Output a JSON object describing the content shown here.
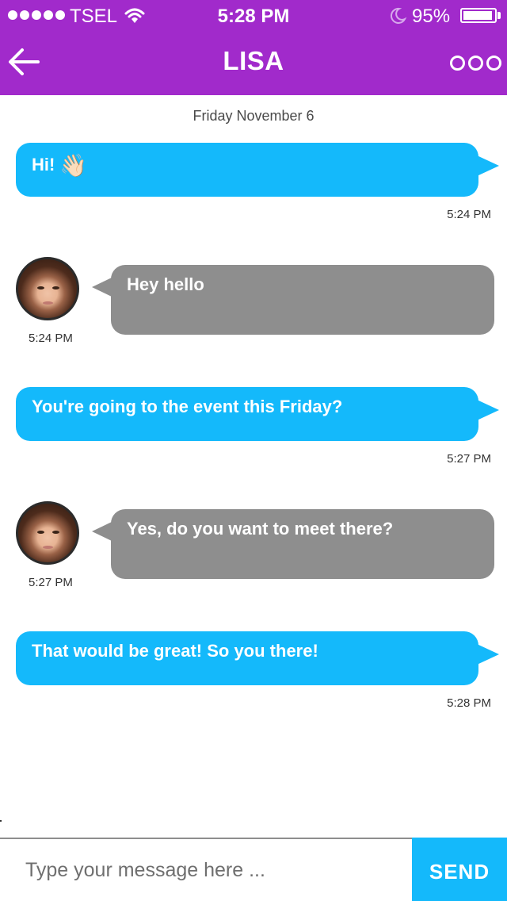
{
  "status_bar": {
    "carrier": "TSEL",
    "time": "5:28 PM",
    "battery_percent": "95%",
    "battery_level": 0.95,
    "signal_icon": "signal-dots-icon",
    "wifi_icon": "wifi-icon",
    "moon_icon": "moon-icon"
  },
  "nav": {
    "title": "LISA",
    "back_icon": "arrow-left-icon",
    "more_icon": "more-dots-icon"
  },
  "chat": {
    "date": "Friday November 6",
    "messages": [
      {
        "direction": "out",
        "text": "Hi!",
        "emoji": "👋🏻",
        "time": "5:24 PM"
      },
      {
        "direction": "in",
        "text": "Hey hello",
        "time": "5:24 PM"
      },
      {
        "direction": "out",
        "text": "You're going to the event this Friday?",
        "time": "5:27 PM"
      },
      {
        "direction": "in",
        "text": "Yes, do you want to meet there?",
        "time": "5:27 PM"
      },
      {
        "direction": "out",
        "text": "That would be great! So you there!",
        "time": "5:28 PM"
      }
    ]
  },
  "composer": {
    "placeholder": "Type your message here ...",
    "value": "",
    "send_label": "SEND"
  },
  "colors": {
    "header": "#a12acb",
    "outgoing_bubble": "#14b9fb",
    "incoming_bubble": "#8e8e8e",
    "send_button": "#14b9fb"
  }
}
